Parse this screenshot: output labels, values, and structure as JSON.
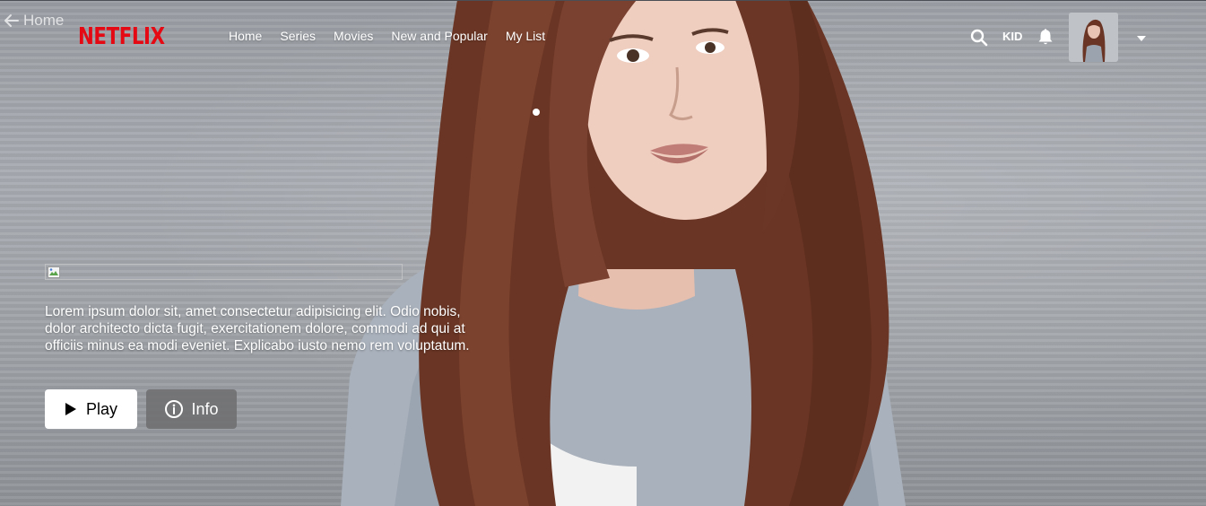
{
  "back": {
    "label": "Home",
    "icon": "arrow-left-icon"
  },
  "brand": {
    "logo_text": "NETFLIX",
    "color": "#e50914"
  },
  "nav": {
    "items": [
      {
        "label": "Home"
      },
      {
        "label": "Series"
      },
      {
        "label": "Movies"
      },
      {
        "label": "New and Popular"
      },
      {
        "label": "My List"
      }
    ]
  },
  "header_right": {
    "search_icon": "search-icon",
    "kid_label": "KID",
    "notification_icon": "bell-icon",
    "profile_caret_icon": "caret-down-icon"
  },
  "hero": {
    "description": "Lorem ipsum dolor sit, amet consectetur adipisicing elit. Odio nobis, dolor architecto dicta fugit, exercitationem dolore, commodi ad qui at officiis minus ea modi eveniet. Explicabo iusto nemo rem voluptatum.",
    "play_label": "Play",
    "info_label": "Info",
    "play_icon": "play-icon",
    "info_icon": "info-circle-icon"
  }
}
